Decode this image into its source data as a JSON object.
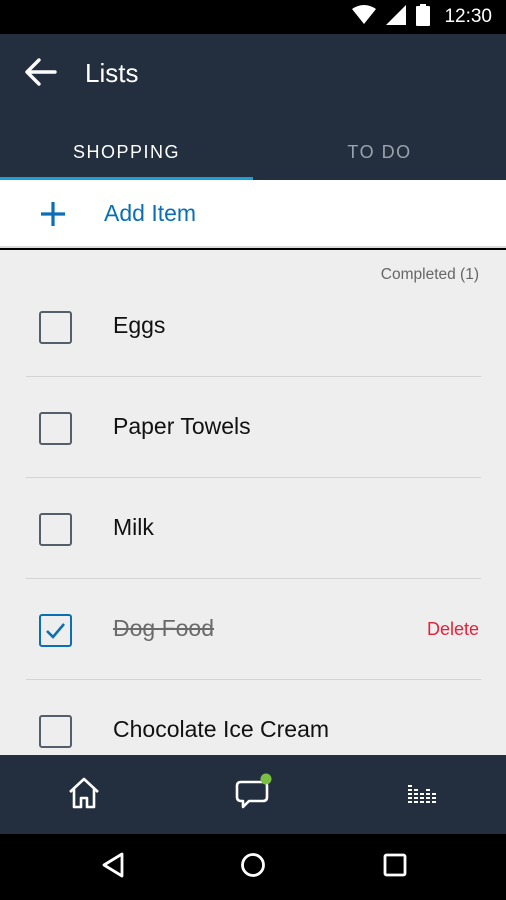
{
  "status_bar": {
    "time": "12:30",
    "icons": [
      "wifi-icon",
      "signal-icon",
      "battery-icon"
    ]
  },
  "header": {
    "title": "Lists",
    "back_icon": "arrow-left-icon"
  },
  "tabs": [
    {
      "label": "SHOPPING",
      "active": true
    },
    {
      "label": "TO DO",
      "active": false
    }
  ],
  "add_item": {
    "label": "Add Item",
    "icon": "plus-icon"
  },
  "list": {
    "completed_label": "Completed (1)",
    "items": [
      {
        "label": "Eggs",
        "checked": false
      },
      {
        "label": "Paper Towels",
        "checked": false
      },
      {
        "label": "Milk",
        "checked": false
      },
      {
        "label": "Dog Food",
        "checked": true,
        "action": "Delete"
      },
      {
        "label": "Chocolate Ice Cream",
        "checked": false
      }
    ]
  },
  "bottom_nav": {
    "items": [
      "home-icon",
      "chat-icon",
      "equalizer-icon"
    ],
    "notification_dot": true
  },
  "system_nav": {
    "items": [
      "back-triangle-icon",
      "home-circle-icon",
      "recents-square-icon"
    ]
  },
  "colors": {
    "app_bar": "#232f3e",
    "accent": "#1aa0d8",
    "link_blue": "#0a6fb5",
    "delete_red": "#e0243c",
    "list_bg": "#eeeeee",
    "notification_green": "#7ac143"
  }
}
